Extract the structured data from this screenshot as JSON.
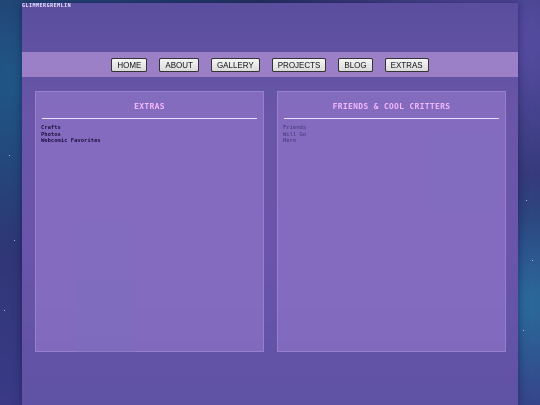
{
  "site": {
    "title": "GLIMMERGREMLIN"
  },
  "nav": {
    "items": [
      {
        "label": "HOME"
      },
      {
        "label": "ABOUT"
      },
      {
        "label": "GALLERY"
      },
      {
        "label": "PROJECTS"
      },
      {
        "label": "BLOG"
      },
      {
        "label": "EXTRAS"
      }
    ]
  },
  "extras_panel": {
    "heading": "EXTRAS",
    "links": [
      "Crafts",
      "Photos",
      "Webcomic Favorites"
    ]
  },
  "friends_panel": {
    "heading": "FRIENDS & COOL CRITTERS",
    "lines": [
      "Friends",
      "Will Go",
      "Here"
    ]
  },
  "colors": {
    "heading": "#f2b8ff",
    "nav_bar": "#9b80c8",
    "frame": "#6a56a8"
  }
}
